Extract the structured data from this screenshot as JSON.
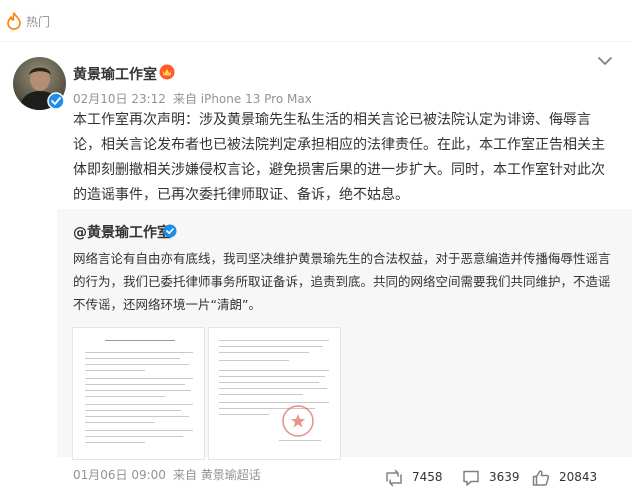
{
  "hot": {
    "label": "热门"
  },
  "post": {
    "author": "黄景瑜工作室",
    "date": "02月10日 23:12",
    "source": "来自 iPhone 13 Pro Max",
    "text_lines": [
      "本工作室再次声明：涉及黄景瑜先生私生活的相关言论已被法院认定为诽谤、侮辱言",
      "论，相关言论发布者也已被法院判定承担相应的法律责任。在此，本工作室正告相关主",
      "体即刻删撤相关涉嫌侵权言论，避免损害后果的进一步扩大。同时，本工作室针对此次",
      "的造谣事件，已再次委托律师取证、备诉，绝不姑息。"
    ]
  },
  "repost": {
    "author": "@黄景瑜工作室",
    "text_lines": [
      "网络言论有自由亦有底线，我司坚决维护黄景瑜先生的合法权益，对于恶意编造并传播侮辱性谣言",
      "的行为，我们已委托律师事务所取证备诉，追责到底。共同的网络空间需要我们共同维护，不造谣",
      "不传谣，还网络环境一片“清朗”。"
    ],
    "date": "01月06日 09:00",
    "source": "来自 黄景瑜超话"
  },
  "actions": {
    "reposts": "7458",
    "comments": "3639",
    "likes": "20843"
  },
  "colors": {
    "accent_orange": "#ff8200",
    "verified_blue": "#1f8ee8",
    "meta_gray": "#939393",
    "repost_bg": "#f7f7f7"
  },
  "icons": [
    "fire-icon",
    "verified-icon",
    "vip-crown-icon",
    "chevron-down-icon",
    "repost-icon",
    "comment-icon",
    "like-icon"
  ]
}
